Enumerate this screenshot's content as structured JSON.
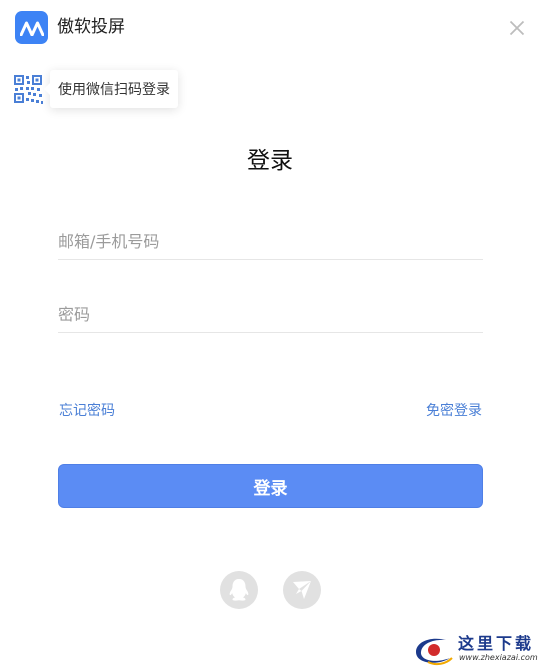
{
  "header": {
    "app_title": "傲软投屏",
    "logo_icon": "apowermirror-logo-icon",
    "close_icon": "close-icon"
  },
  "qr_login": {
    "icon": "qr-code-icon",
    "tooltip": "使用微信扫码登录"
  },
  "form": {
    "title": "登录",
    "email_placeholder": "邮箱/手机号码",
    "email_value": "",
    "password_placeholder": "密码",
    "password_value": "",
    "forgot_password": "忘记密码",
    "passwordless_login": "免密登录",
    "submit_label": "登录"
  },
  "social": [
    {
      "icon": "qq-icon"
    },
    {
      "icon": "paper-plane-icon"
    }
  ],
  "watermark": {
    "text": "这里下载",
    "url": "www.zhexiazai.com"
  },
  "colors": {
    "accent": "#5b8cf4",
    "link": "#4a7fd6",
    "logo": "#3d83f5",
    "social_bg": "#e1e1e1"
  }
}
